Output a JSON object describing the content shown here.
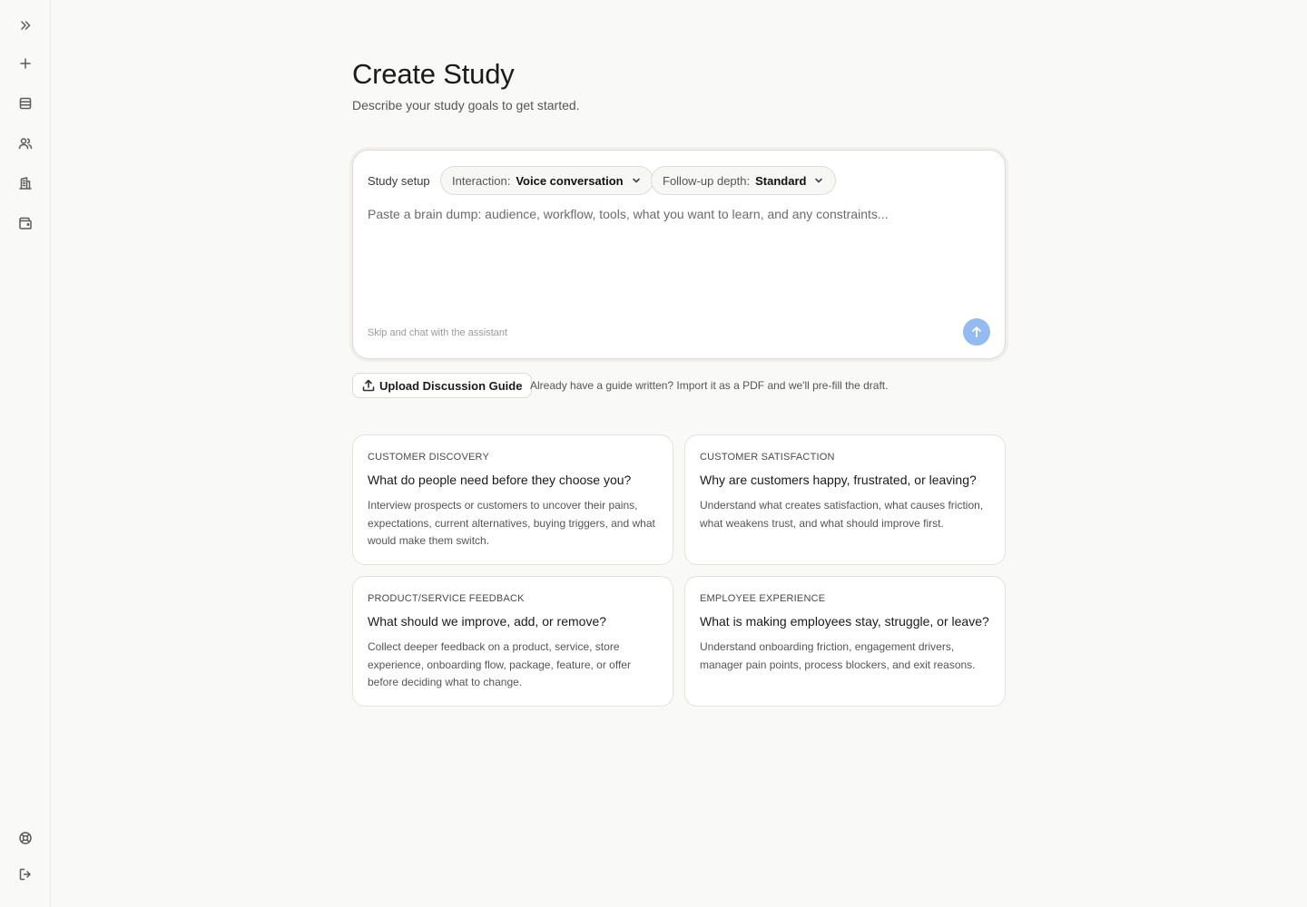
{
  "sidebar": {
    "top_icons": [
      "expand-icon",
      "plus-icon",
      "studies-list-icon",
      "participants-icon",
      "building-icon",
      "wallet-icon"
    ],
    "bottom_icons": [
      "help-lifebuoy-icon",
      "logout-icon"
    ]
  },
  "header": {
    "title": "Create Study",
    "subtitle": "Describe your study goals to get started."
  },
  "composer": {
    "setup_label": "Study setup",
    "interaction_label": "Interaction:",
    "interaction_value": "Voice conversation",
    "depth_label": "Follow-up depth:",
    "depth_value": "Standard",
    "placeholder": "Paste a brain dump: audience, workflow, tools, what you want to learn, and any constraints...",
    "value": "",
    "skip_label": "Skip and chat with the assistant"
  },
  "upload": {
    "button_label": "Upload Discussion Guide",
    "hint": "Already have a guide written? Import it as a PDF and we'll pre-fill the draft."
  },
  "templates": [
    {
      "category": "Customer Discovery",
      "question": "What do people need before they choose you?",
      "description": "Interview prospects or customers to uncover their pains, expectations, current alternatives, buying triggers, and what would make them switch."
    },
    {
      "category": "Customer Satisfaction",
      "question": "Why are customers happy, frustrated, or leaving?",
      "description": "Understand what creates satisfaction, what causes friction, what weakens trust, and what should improve first."
    },
    {
      "category": "Product/Service Feedback",
      "question": "What should we improve, add, or remove?",
      "description": "Collect deeper feedback on a product, service, store experience, onboarding flow, package, feature, or offer before deciding what to change."
    },
    {
      "category": "Employee Experience",
      "question": "What is making employees stay, struggle, or leave?",
      "description": "Understand onboarding friction, engagement drivers, manager pain points, process blockers, and exit reasons."
    }
  ],
  "colors": {
    "background": "#f9f9f7",
    "send_button": "#93bbf0",
    "card_border": "#e3e2dd"
  }
}
